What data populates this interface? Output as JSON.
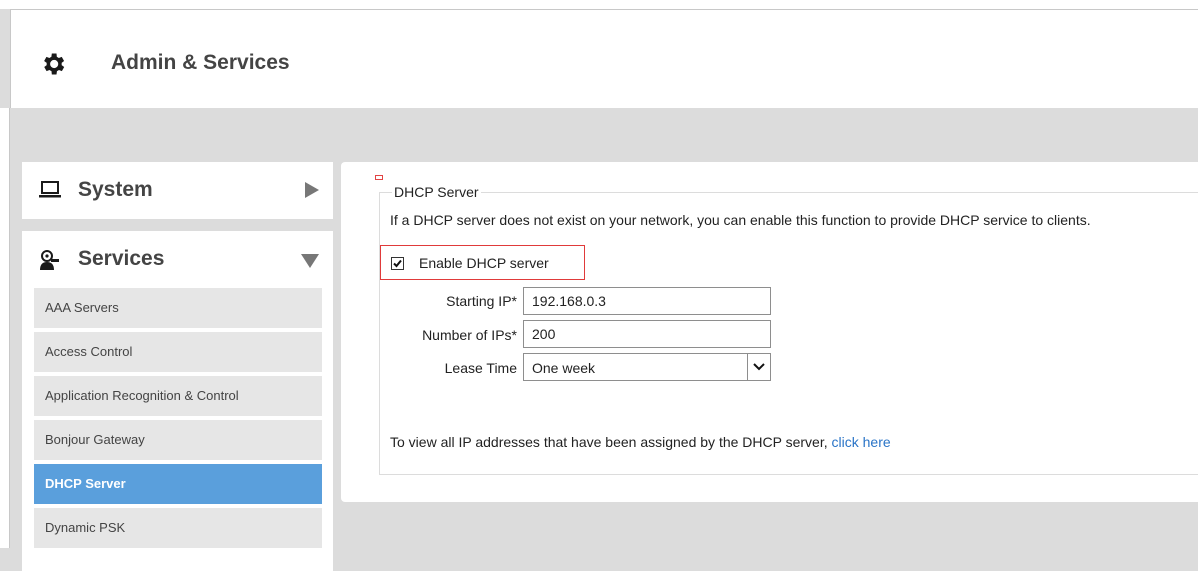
{
  "header": {
    "title": "Admin & Services",
    "icon": "gear-icon"
  },
  "sidebar": {
    "system": {
      "label": "System",
      "icon": "laptop-icon",
      "arrow": "caret-right-icon"
    },
    "services": {
      "label": "Services",
      "icon": "services-icon",
      "arrow": "caret-down-icon",
      "items": [
        {
          "label": "AAA Servers"
        },
        {
          "label": "Access Control"
        },
        {
          "label": "Application Recognition & Control"
        },
        {
          "label": "Bonjour Gateway"
        },
        {
          "label": "DHCP Server"
        },
        {
          "label": "Dynamic PSK"
        }
      ],
      "active_item": "DHCP Server"
    }
  },
  "dhcp": {
    "legend": "DHCP Server",
    "description": "If a DHCP server does not exist on your network, you can enable this function to provide DHCP service to clients.",
    "enable_label": "Enable DHCP server",
    "enabled": true,
    "starting_ip_label": "Starting IP*",
    "starting_ip_value": "192.168.0.3",
    "num_ips_label": "Number of IPs*",
    "num_ips_value": "200",
    "lease_time_label": "Lease Time",
    "lease_time_value": "One week",
    "footer_text": "To view all IP addresses that have been assigned by the DHCP server, ",
    "footer_link": "click here"
  },
  "colors": {
    "accent": "#5a9fdc",
    "link": "#2a74c7",
    "highlight_border": "#e03a3a"
  }
}
